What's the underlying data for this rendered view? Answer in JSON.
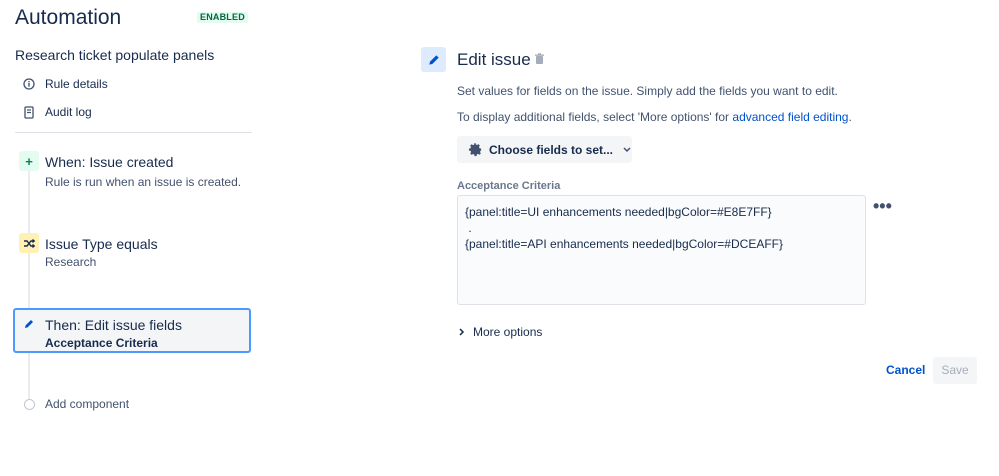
{
  "header": {
    "app_title": "Automation",
    "status_badge": "ENABLED",
    "rule_name": "Research ticket populate panels"
  },
  "nav": {
    "rule_details": "Rule details",
    "audit_log": "Audit log"
  },
  "steps": {
    "trigger": {
      "title": "When: Issue created",
      "subtitle": "Rule is run when an issue is created."
    },
    "condition": {
      "title": "Issue Type equals",
      "subtitle": "Research"
    },
    "action": {
      "title": "Then: Edit issue fields",
      "subtitle": "Acceptance Criteria"
    },
    "add_component": "Add component"
  },
  "panel": {
    "title": "Edit issue",
    "desc1": "Set values for fields on the issue. Simply add the fields you want to edit.",
    "desc2_prefix": "To display additional fields, select 'More options' for ",
    "desc2_link": "advanced field editing",
    "desc2_suffix": ".",
    "choose_fields": "Choose fields to set...",
    "field_label": "Acceptance Criteria",
    "field_value": "{panel:title=UI enhancements needed|bgColor=#E8E7FF}\n .\n{panel:title=API enhancements needed|bgColor=#DCEAFF}",
    "more_options": "More options",
    "cancel": "Cancel",
    "save": "Save"
  },
  "colors": {
    "accent": "#0052cc",
    "selected_border": "#4c9aff",
    "enabled_bg": "#e3fcef",
    "enabled_text": "#006644"
  }
}
